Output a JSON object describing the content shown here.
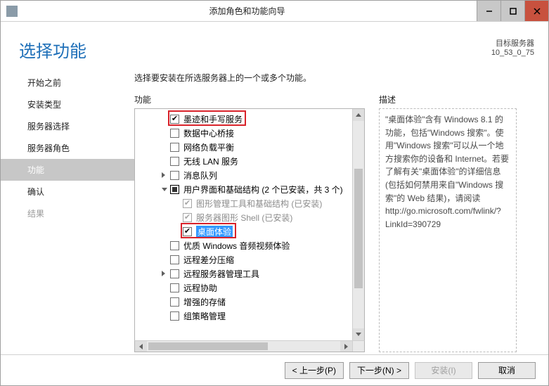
{
  "window": {
    "title": "添加角色和功能向导",
    "target_server_label": "目标服务器",
    "target_server_value": "10_53_0_75"
  },
  "page": {
    "title": "选择功能",
    "instruction": "选择要安装在所选服务器上的一个或多个功能。"
  },
  "sidebar": {
    "items": [
      {
        "label": "开始之前",
        "state": "normal"
      },
      {
        "label": "安装类型",
        "state": "normal"
      },
      {
        "label": "服务器选择",
        "state": "normal"
      },
      {
        "label": "服务器角色",
        "state": "normal"
      },
      {
        "label": "功能",
        "state": "active"
      },
      {
        "label": "确认",
        "state": "normal"
      },
      {
        "label": "结果",
        "state": "disabled"
      }
    ]
  },
  "columns": {
    "features_header": "功能",
    "description_header": "描述"
  },
  "features": [
    {
      "label": "墨迹和手写服务",
      "checked": true,
      "level": 1,
      "highlight": true
    },
    {
      "label": "数据中心桥接",
      "checked": false,
      "level": 1
    },
    {
      "label": "网络负载平衡",
      "checked": false,
      "level": 1
    },
    {
      "label": "无线 LAN 服务",
      "checked": false,
      "level": 1
    },
    {
      "label": "消息队列",
      "checked": false,
      "level": 1,
      "expandable": "collapsed"
    },
    {
      "label": "用户界面和基础结构 (2 个已安装，共 3 个)",
      "checked": "mixed",
      "level": 1,
      "expandable": "expanded"
    },
    {
      "label": "图形管理工具和基础结构 (已安装)",
      "checked": true,
      "level": 2,
      "disabled": true
    },
    {
      "label": "服务器图形 Shell (已安装)",
      "checked": true,
      "level": 2,
      "disabled": true
    },
    {
      "label": "桌面体验",
      "checked": true,
      "level": 2,
      "highlight": true,
      "selected": true
    },
    {
      "label": "优质 Windows 音频视频体验",
      "checked": false,
      "level": 1
    },
    {
      "label": "远程差分压缩",
      "checked": false,
      "level": 1
    },
    {
      "label": "远程服务器管理工具",
      "checked": false,
      "level": 1,
      "expandable": "collapsed"
    },
    {
      "label": "远程协助",
      "checked": false,
      "level": 1
    },
    {
      "label": "增强的存储",
      "checked": false,
      "level": 1
    },
    {
      "label": "组策略管理",
      "checked": false,
      "level": 1
    }
  ],
  "description": "\"桌面体验\"含有 Windows 8.1 的功能，包括\"Windows 搜索\"。使用\"Windows 搜索\"可以从一个地方搜索你的设备和 Internet。若要了解有关\"桌面体验\"的详细信息(包括如何禁用来自\"Windows 搜索\"的 Web 结果)，请阅读 http://go.microsoft.com/fwlink/?LinkId=390729",
  "footer": {
    "prev": "< 上一步(P)",
    "next": "下一步(N) >",
    "install": "安装(I)",
    "cancel": "取消"
  }
}
